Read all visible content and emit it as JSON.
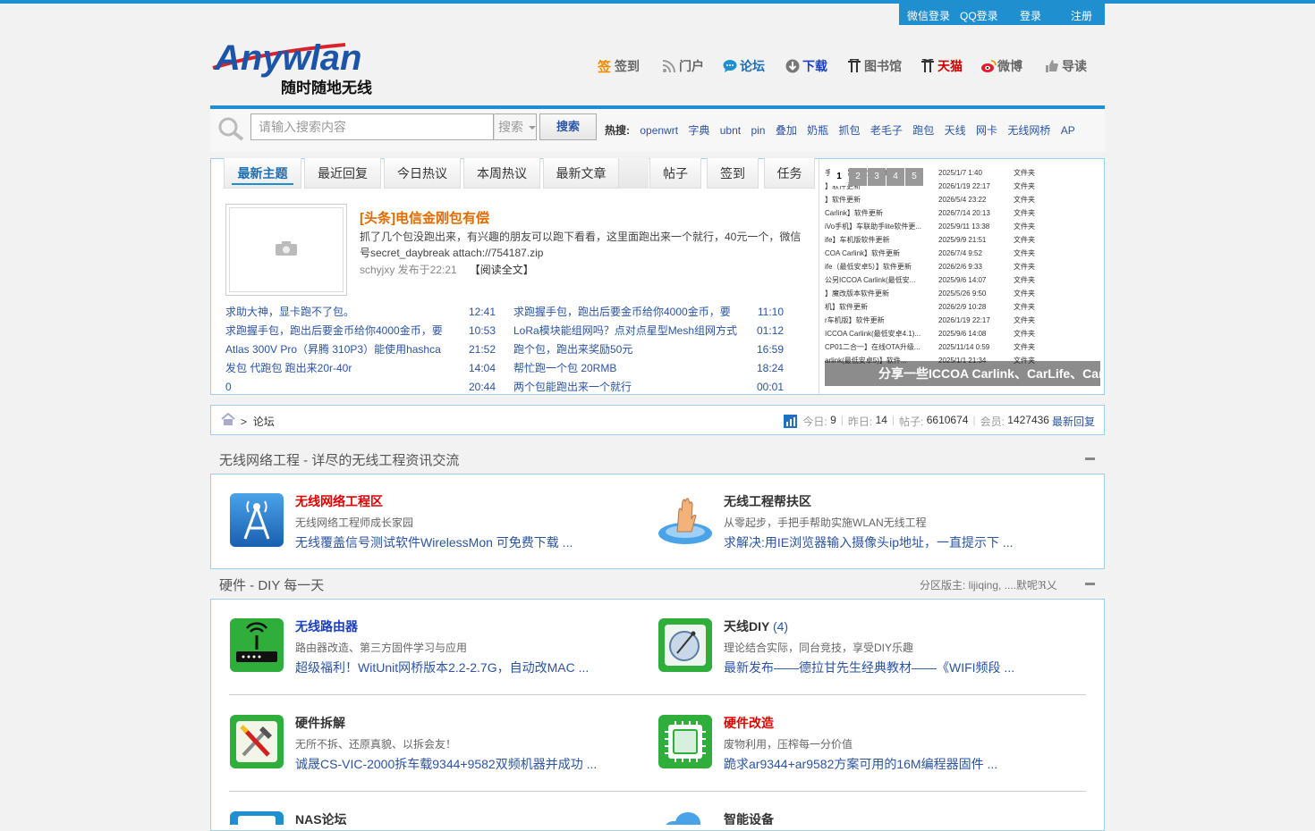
{
  "colors": {
    "accent": "#1f8fd0",
    "link": "#2b54a3",
    "headline": "#e06b00",
    "red_forum": "#e00000",
    "blue_forum": "#1a3fc4"
  },
  "toplinks": {
    "wechat": "微信登录",
    "qq": "QQ登录",
    "login": "登录",
    "register": "注册"
  },
  "logo": {
    "brand": "Anywlan",
    "slogan": "随时随地无线"
  },
  "nav": [
    {
      "label": "签到",
      "icon": "checkin-icon"
    },
    {
      "label": "门户",
      "icon": "rss-icon"
    },
    {
      "label": "论坛",
      "icon": "chat-bubble-icon"
    },
    {
      "label": "下载",
      "icon": "download-icon"
    },
    {
      "label": "图书馆",
      "icon": "library-icon"
    },
    {
      "label": "天猫",
      "icon": "tmall-icon"
    },
    {
      "label": "微博",
      "icon": "weibo-icon"
    },
    {
      "label": "导读",
      "icon": "thumbs-up-icon"
    }
  ],
  "search": {
    "placeholder": "请输入搜索内容",
    "type": "搜索",
    "button": "搜索"
  },
  "hot": {
    "label": "热搜:",
    "terms": [
      "openwrt",
      "字典",
      "ubnt",
      "pin",
      "叠加",
      "奶瓶",
      "抓包",
      "老毛子",
      "跑包",
      "天线",
      "网卡",
      "无线网桥",
      "AP"
    ]
  },
  "tabs": [
    "最新主题",
    "最近回复",
    "今日热议",
    "本周热议",
    "最新文章",
    "帖子",
    "签到",
    "任务"
  ],
  "headline": {
    "title": "[头条]电信金刚包有偿",
    "summary": "抓了几个包没跑出来，有兴趣的朋友可以跑下看看，这里面跑出来一个就行，40元一个，微信号secret_daybreak attach://754187.zip",
    "meta": "schyjxy 发布于22:21",
    "read": "【阅读全文】"
  },
  "threads_left": [
    {
      "title": "求助大神，显卡跑不了包。",
      "time": "12:41"
    },
    {
      "title": "求跑握手包，跑出后要金币给你4000金币，要",
      "time": "10:53"
    },
    {
      "title": "Atlas 300V Pro（昇腾 310P3）能使用hashca",
      "time": "21:52"
    },
    {
      "title": "发包 代跑包 跑出来20r-40r",
      "time": "14:04"
    },
    {
      "title": "0",
      "time": "20:44"
    }
  ],
  "threads_right": [
    {
      "title": "求跑握手包，跑出后要金币给你4000金币，要",
      "time": "11:10"
    },
    {
      "title": "LoRa模块能组网吗？点对点星型Mesh组网方式",
      "time": "01:12"
    },
    {
      "title": "跑个包，跑出来奖励50元",
      "time": "16:59"
    },
    {
      "title": "帮忙跑一个包 20RMB",
      "time": "18:24"
    },
    {
      "title": "两个包能跑出来一个就行",
      "time": "00:01"
    }
  ],
  "slide": {
    "caption": "分享一些ICCOA Carlink、CarLife、CarWith、",
    "pages": [
      "1",
      "2",
      "3",
      "4",
      "5"
    ],
    "files": [
      {
        "name": "手机端版本软件更新",
        "date": "2025/1/7 1:40",
        "type": "文件夹"
      },
      {
        "name": "】软件更新",
        "date": "2026/1/19 22:17",
        "type": "文件夹"
      },
      {
        "name": "】软件更新",
        "date": "2026/5/4 23:22",
        "type": "文件夹"
      },
      {
        "name": "Carlink】软件更新",
        "date": "2026/7/14 20:13",
        "type": "文件夹"
      },
      {
        "name": "iVo手机】车联助手lite软件更...",
        "date": "2025/9/11 13:38",
        "type": "文件夹"
      },
      {
        "name": "ife】车机版软件更新",
        "date": "2025/9/9 21:51",
        "type": "文件夹"
      },
      {
        "name": "COA Carlink】软件更新",
        "date": "2026/7/4 9:52",
        "type": "文件夹"
      },
      {
        "name": "ife（最低安卓5）】软件更新",
        "date": "2026/2/6 9:33",
        "type": "文件夹"
      },
      {
        "name": "公另ICCOA Carlink(最低安...",
        "date": "2025/9/6 14:07",
        "type": "文件夹"
      },
      {
        "name": "】魔改版本软件更新",
        "date": "2025/5/26 9:50",
        "type": "文件夹"
      },
      {
        "name": "机】软件更新",
        "date": "2026/2/9 10:28",
        "type": "文件夹"
      },
      {
        "name": "r车机版】软件更新",
        "date": "2026/1/19 22:17",
        "type": "文件夹"
      },
      {
        "name": "ICCOA Carlink(最低安卓4.1)...",
        "date": "2025/9/6 14:08",
        "type": "文件夹"
      },
      {
        "name": "CP01二合一】在线OTA升级...",
        "date": "2025/11/14 0:59",
        "type": "文件夹"
      },
      {
        "name": "arlink(最低安卓5)】软件...",
        "date": "2025/1/1 21:34",
        "type": "文件夹"
      }
    ]
  },
  "crumb": {
    "path": "论坛",
    "today_label": "今日:",
    "today": "9",
    "yesterday_label": "昨日:",
    "yesterday": "14",
    "posts_label": "帖子:",
    "posts": "6610674",
    "members_label": "会员:",
    "members": "1427436",
    "latest": "最新回复"
  },
  "sections": [
    {
      "title": "无线网络工程 - 详尽的无线工程资讯交流"
    },
    {
      "title": "硬件 - DIY 每一天",
      "moderators": "分区版主: lijiqing,    ....默呢ℜ乂"
    }
  ],
  "forums": [
    {
      "name": "无线网络工程区",
      "desc": "无线网络工程师成长家园",
      "last": "无线覆盖信号测试软件WirelessMon 可免费下载 ...",
      "icon": "tower-icon"
    },
    {
      "name": "无线工程帮扶区",
      "desc": "从零起步，手把手帮助实施WLAN无线工程",
      "last": "求解决:用IE浏览器输入摄像头ip地址，一直提示下 ...",
      "icon": "help-hand-icon"
    },
    {
      "name": "无线路由器",
      "desc": "路由器改造、第三方固件学习与应用",
      "last": "超级福利！WitUnit网桥版本2.2-2.7G，自动改MAC ...",
      "icon": "router-icon"
    },
    {
      "name": "天线DIY",
      "count": "(4)",
      "desc": "理论结合实际，同台竞技，享受DIY乐趣",
      "last": "最新发布——德拉甘先生经典教材——《WIFI频段 ...",
      "icon": "dish-antenna-icon"
    },
    {
      "name": "硬件拆解",
      "desc": "无所不拆、还原真貌、以拆会友！",
      "last": "诚晟CS-VIC-2000拆车载9344+9582双频机器并成功 ...",
      "icon": "tools-icon"
    },
    {
      "name": "硬件改造",
      "desc": "废物利用，压榨每一分价值",
      "last": "跪求ar9344+ar9582方案可用的16M编程器固件 ...",
      "icon": "chip-icon"
    },
    {
      "name": "NAS论坛",
      "icon": "nas-icon"
    },
    {
      "name": "智能设备",
      "icon": "cloud-icon"
    }
  ]
}
